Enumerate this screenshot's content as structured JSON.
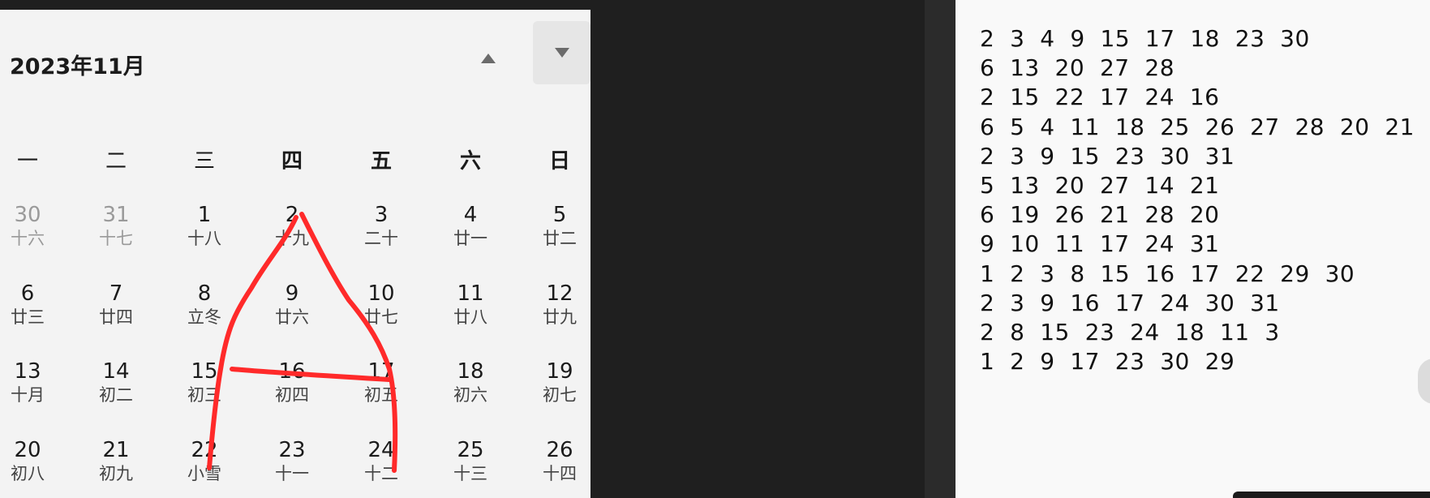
{
  "calendar": {
    "title": "2023年11月",
    "weekdays": [
      "一",
      "二",
      "三",
      "四",
      "五",
      "六",
      "日"
    ],
    "rows": [
      [
        {
          "num": "30",
          "lunar": "十六",
          "dim": true
        },
        {
          "num": "31",
          "lunar": "十七",
          "dim": true
        },
        {
          "num": "1",
          "lunar": "十八"
        },
        {
          "num": "2",
          "lunar": "十九"
        },
        {
          "num": "3",
          "lunar": "二十"
        },
        {
          "num": "4",
          "lunar": "廿一"
        },
        {
          "num": "5",
          "lunar": "廿二"
        }
      ],
      [
        {
          "num": "6",
          "lunar": "廿三"
        },
        {
          "num": "7",
          "lunar": "廿四"
        },
        {
          "num": "8",
          "lunar": "立冬"
        },
        {
          "num": "9",
          "lunar": "廿六"
        },
        {
          "num": "10",
          "lunar": "廿七"
        },
        {
          "num": "11",
          "lunar": "廿八"
        },
        {
          "num": "12",
          "lunar": "廿九"
        }
      ],
      [
        {
          "num": "13",
          "lunar": "十月"
        },
        {
          "num": "14",
          "lunar": "初二"
        },
        {
          "num": "15",
          "lunar": "初三"
        },
        {
          "num": "16",
          "lunar": "初四"
        },
        {
          "num": "17",
          "lunar": "初五"
        },
        {
          "num": "18",
          "lunar": "初六"
        },
        {
          "num": "19",
          "lunar": "初七"
        }
      ],
      [
        {
          "num": "20",
          "lunar": "初八"
        },
        {
          "num": "21",
          "lunar": "初九"
        },
        {
          "num": "22",
          "lunar": "小雪"
        },
        {
          "num": "23",
          "lunar": "十一"
        },
        {
          "num": "24",
          "lunar": "十二"
        },
        {
          "num": "25",
          "lunar": "十三"
        },
        {
          "num": "26",
          "lunar": "十四"
        }
      ]
    ],
    "annotation_color": "#ff2a2a"
  },
  "notes": {
    "lines": [
      "2  3  4  9  15  17  18  23  30",
      "6  13  20  27  28",
      "2  15  22  17  24  16",
      "6  5  4  11  18  25  26  27  28  20  21",
      "2  3  9  15  23  30  31",
      "5  13  20  27  14  21",
      "6  19  26  21  28  20",
      "9  10  11  17  24  31",
      "1  2  3  8  15  16  17  22  29  30",
      "2  3  9  16  17  24  30  31",
      "2  8  15  23  24  18  11  3",
      "1  2  9  17  23  30  29"
    ]
  }
}
